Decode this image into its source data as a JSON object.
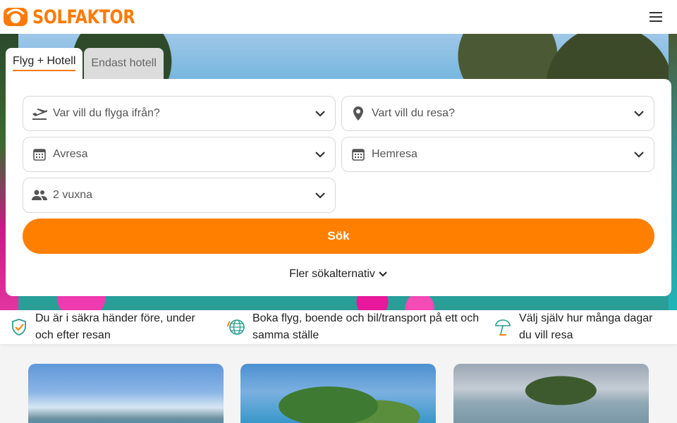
{
  "header": {
    "brand": "SOLFAKTOR"
  },
  "tabs": [
    {
      "label": "Flyg + Hotell",
      "active": true
    },
    {
      "label": "Endast hotell",
      "active": false
    }
  ],
  "search": {
    "from": {
      "placeholder": "Var vill du flyga ifrån?",
      "icon": "plane-departure-icon"
    },
    "to": {
      "placeholder": "Vart vill du resa?",
      "icon": "map-pin-icon"
    },
    "departure": {
      "placeholder": "Avresa",
      "icon": "calendar-icon"
    },
    "return": {
      "placeholder": "Hemresa",
      "icon": "calendar-icon"
    },
    "travelers": {
      "value": "2 vuxna",
      "icon": "people-icon"
    },
    "submit_label": "Sök",
    "more_options_label": "Fler sökalternativ"
  },
  "usp": [
    {
      "text": "Du är i säkra händer före, under och efter resan",
      "icon": "shield-check-icon"
    },
    {
      "text": "Boka flyg, boende och bil/transport på ett och samma ställe",
      "icon": "globe-icon"
    },
    {
      "text": "Välj själv hur många dagar du vill resa",
      "icon": "beach-umbrella-icon"
    }
  ],
  "colors": {
    "accent": "#ff7f00",
    "icon_teal": "#2a9d8f"
  }
}
